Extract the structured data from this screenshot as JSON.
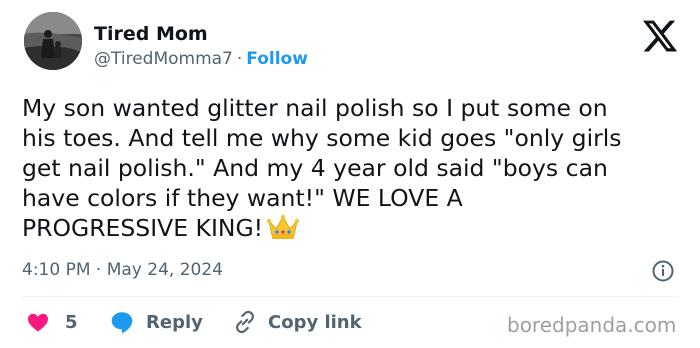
{
  "author": {
    "name": "Tired Mom",
    "handle": "@TiredMomma7",
    "separator": "·",
    "follow_label": "Follow"
  },
  "icons": {
    "logo": "x-logo",
    "avatar": "avatar-photo",
    "crown": "crown-emoji",
    "info": "info-icon",
    "like": "heart-icon",
    "reply": "reply-bubble-icon",
    "copy": "link-icon"
  },
  "tweet": {
    "lines": [
      "My son wanted glitter nail polish so I put some on",
      "his toes. And tell me why some kid goes \"only girls",
      "get nail polish.\" And my 4 year old said \"boys can",
      "have colors if they want!\" WE LOVE A",
      "PROGRESSIVE KING!"
    ]
  },
  "meta": {
    "time": "4:10 PM",
    "separator": "·",
    "date": "May 24, 2024"
  },
  "actions": {
    "likes": "5",
    "reply_label": "Reply",
    "copy_label": "Copy link"
  },
  "watermark": "boredpanda.com",
  "colors": {
    "accent": "#1d9bf0",
    "like": "#f91880",
    "muted": "#536471",
    "text": "#0f1419"
  }
}
